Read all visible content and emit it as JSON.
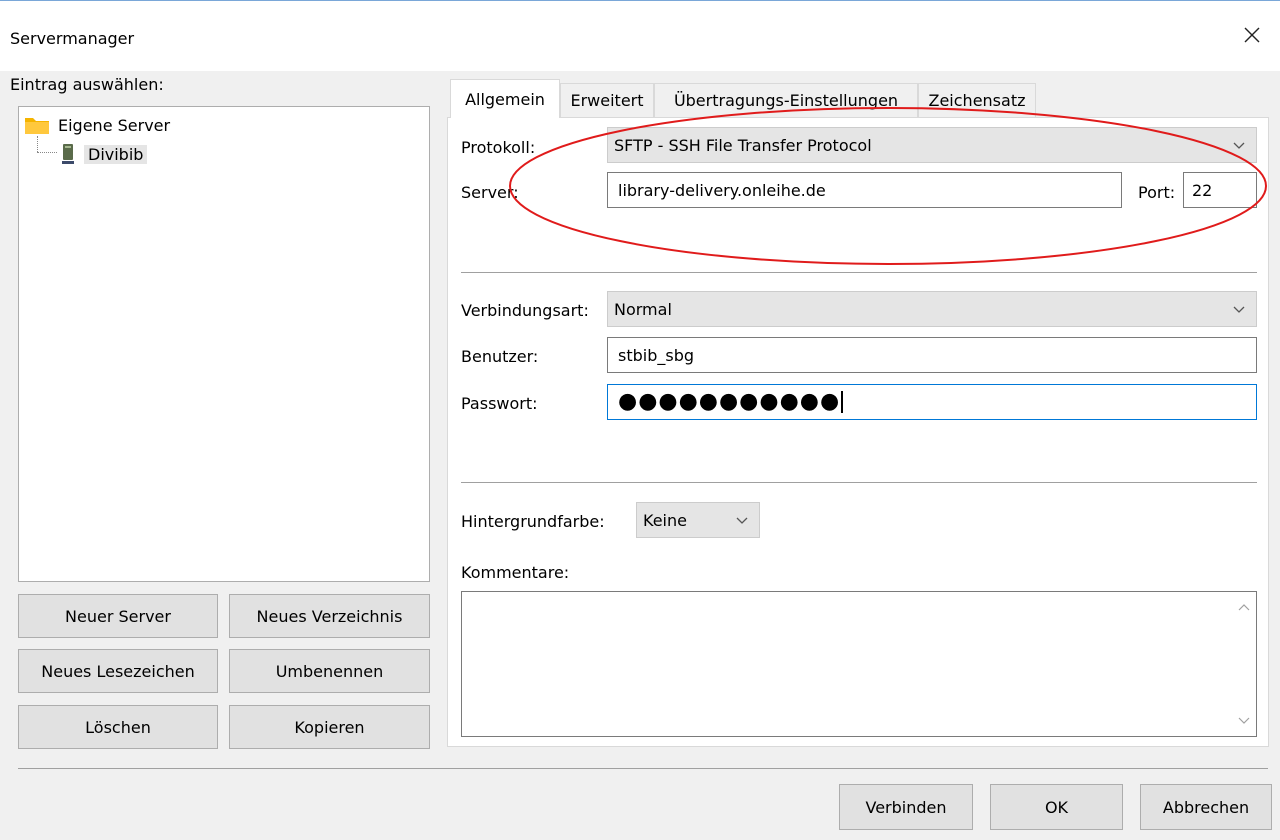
{
  "window": {
    "title": "Servermanager"
  },
  "left": {
    "select_label": "Eintrag auswählen:",
    "tree": {
      "root": "Eigene Server",
      "child": "Divibib"
    },
    "buttons": {
      "new_server": "Neuer Server",
      "new_folder": "Neues Verzeichnis",
      "new_bookmark": "Neues Lesezeichen",
      "rename": "Umbenennen",
      "delete": "Löschen",
      "copy": "Kopieren"
    }
  },
  "tabs": [
    "Allgemein",
    "Erweitert",
    "Übertragungs-Einstellungen",
    "Zeichensatz"
  ],
  "general": {
    "protocol_label": "Protokoll:",
    "protocol_value": "SFTP - SSH File Transfer Protocol",
    "server_label": "Server:",
    "server_value": "library-delivery.onleihe.de",
    "port_label": "Port:",
    "port_value": "22",
    "logon_type_label": "Verbindungsart:",
    "logon_type_value": "Normal",
    "user_label": "Benutzer:",
    "user_value": "stbib_sbg",
    "password_label": "Passwort:",
    "password_value": "●●●●●●●●●●●",
    "bgcolor_label": "Hintergrundfarbe:",
    "bgcolor_value": "Keine",
    "comments_label": "Kommentare:",
    "comments_value": ""
  },
  "footer": {
    "connect": "Verbinden",
    "ok": "OK",
    "cancel": "Abbrechen"
  },
  "colors": {
    "annotation": "#e01b1b",
    "focus": "#0078d7",
    "folder": "#f5b400"
  }
}
